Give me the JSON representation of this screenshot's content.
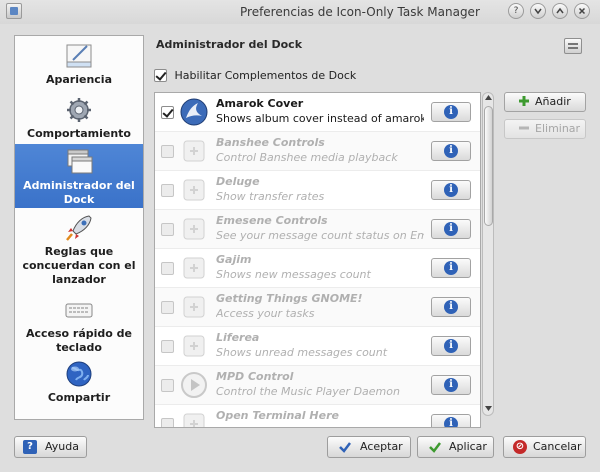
{
  "window": {
    "title": "Preferencias de Icon-Only Task Manager"
  },
  "titlebar_buttons": {
    "help": "?",
    "minimize": "v",
    "maximize": "^",
    "close": "x"
  },
  "sidebar": {
    "items": [
      {
        "label": "Apariencia",
        "icon": "appearance-icon"
      },
      {
        "label": "Comportamiento",
        "icon": "gear-icon"
      },
      {
        "label": "Administrador del Dock",
        "icon": "windows-icon",
        "selected": true
      },
      {
        "label": "Reglas que concuerdan con el lanzador",
        "icon": "rocket-icon"
      },
      {
        "label": "Acceso rápido de teclado",
        "icon": "keyboard-icon"
      },
      {
        "label": "Compartir",
        "icon": "globe-icon"
      }
    ]
  },
  "main": {
    "title": "Administrador del Dock",
    "enable_label": "Habilitar Complementos de Dock",
    "enable_checked": true
  },
  "plugins": [
    {
      "title": "Amarok Cover",
      "description": "Shows album cover instead of amarok ...",
      "checked": true,
      "enabled": true,
      "icon": "amarok-icon"
    },
    {
      "title": "Banshee Controls",
      "description": "Control Banshee media playback",
      "checked": false,
      "enabled": false,
      "icon": "plugin-icon"
    },
    {
      "title": "Deluge",
      "description": "Show transfer rates",
      "checked": false,
      "enabled": false,
      "icon": "plugin-icon"
    },
    {
      "title": "Emesene Controls",
      "description": "See your message count status on Em...",
      "checked": false,
      "enabled": false,
      "icon": "plugin-icon"
    },
    {
      "title": "Gajim",
      "description": "Shows new messages count",
      "checked": false,
      "enabled": false,
      "icon": "plugin-icon"
    },
    {
      "title": "Getting Things GNOME!",
      "description": "Access your tasks",
      "checked": false,
      "enabled": false,
      "icon": "plugin-icon"
    },
    {
      "title": "Liferea",
      "description": "Shows unread messages count",
      "checked": false,
      "enabled": false,
      "icon": "plugin-icon"
    },
    {
      "title": "MPD Control",
      "description": "Control the Music Player Daemon",
      "checked": false,
      "enabled": false,
      "icon": "play-icon"
    },
    {
      "title": "Open Terminal Here",
      "description": "",
      "checked": false,
      "enabled": false,
      "icon": "plugin-icon"
    }
  ],
  "side_buttons": {
    "add": "Añadir",
    "remove": "Eliminar"
  },
  "bottom_buttons": {
    "help": "Ayuda",
    "accept": "Aceptar",
    "apply": "Aplicar",
    "cancel": "Cancelar"
  },
  "colors": {
    "selection": "#3a72c9",
    "info": "#2f62b7",
    "accept": "#2f62b7",
    "apply": "#3d9a2f",
    "cancel": "#c42a2a",
    "add": "#3d9a2f"
  }
}
